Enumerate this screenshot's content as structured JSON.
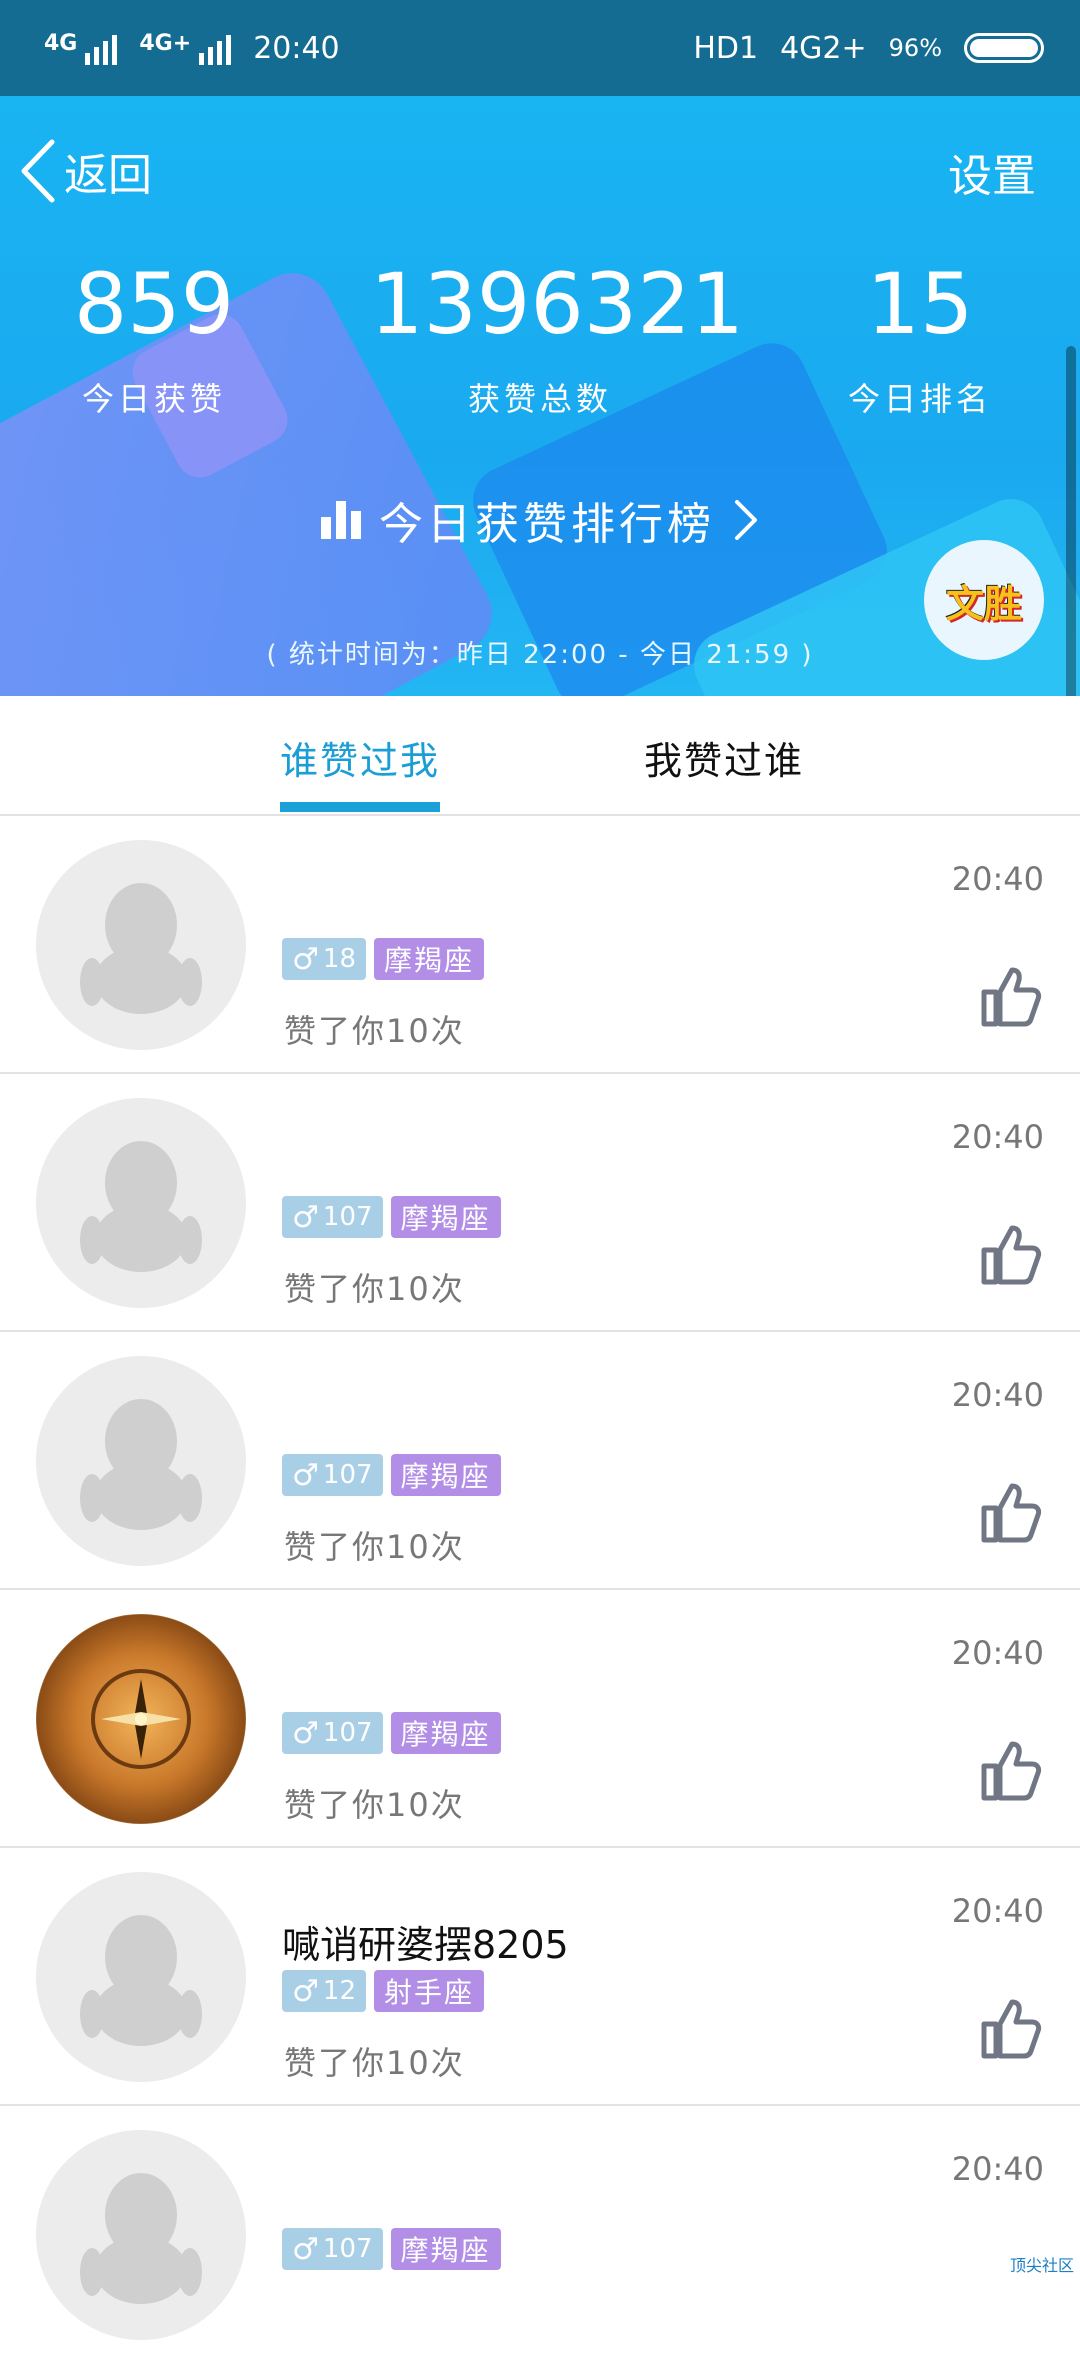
{
  "status_bar": {
    "net1": "4G",
    "net2": "4G+",
    "time": "20:40",
    "hd": "HD1",
    "net3": "4G2+",
    "battery": "96%"
  },
  "nav": {
    "back_label": "返回",
    "settings_label": "设置"
  },
  "stats": [
    {
      "value": "859",
      "label": "今日获赞"
    },
    {
      "value": "1396321",
      "label": "获赞总数"
    },
    {
      "value": "15",
      "label": "今日排名"
    }
  ],
  "rank_link": "今日获赞排行榜",
  "period": "( 统计时间为：昨日 22:00 - 今日 21:59 )",
  "badge": "文胜",
  "tabs": [
    {
      "label": "谁赞过我",
      "active": true
    },
    {
      "label": "我赞过谁",
      "active": false
    }
  ],
  "rows": [
    {
      "name": "",
      "age": "18",
      "zodiac": "摩羯座",
      "likes": "赞了你10次",
      "time": "20:40",
      "avatar": "default"
    },
    {
      "name": "",
      "age": "107",
      "zodiac": "摩羯座",
      "likes": "赞了你10次",
      "time": "20:40",
      "avatar": "default"
    },
    {
      "name": "",
      "age": "107",
      "zodiac": "摩羯座",
      "likes": "赞了你10次",
      "time": "20:40",
      "avatar": "default"
    },
    {
      "name": "",
      "age": "107",
      "zodiac": "摩羯座",
      "likes": "赞了你10次",
      "time": "20:40",
      "avatar": "compass"
    },
    {
      "name": "喊诮研婆摆8205",
      "age": "12",
      "zodiac": "射手座",
      "likes": "赞了你10次",
      "time": "20:40",
      "avatar": "default"
    },
    {
      "name": "",
      "age": "107",
      "zodiac": "摩羯座",
      "likes": "",
      "time": "20:40",
      "avatar": "default"
    }
  ],
  "male_symbol": "♂",
  "watermark": "顶尖社区",
  "colors": {
    "status_bar": "#156c92",
    "header": "#19b4f2",
    "tab_active": "#1a9ed5",
    "tag_sex": "#a9cfe6",
    "tag_zodiac": "#b28ee6"
  }
}
